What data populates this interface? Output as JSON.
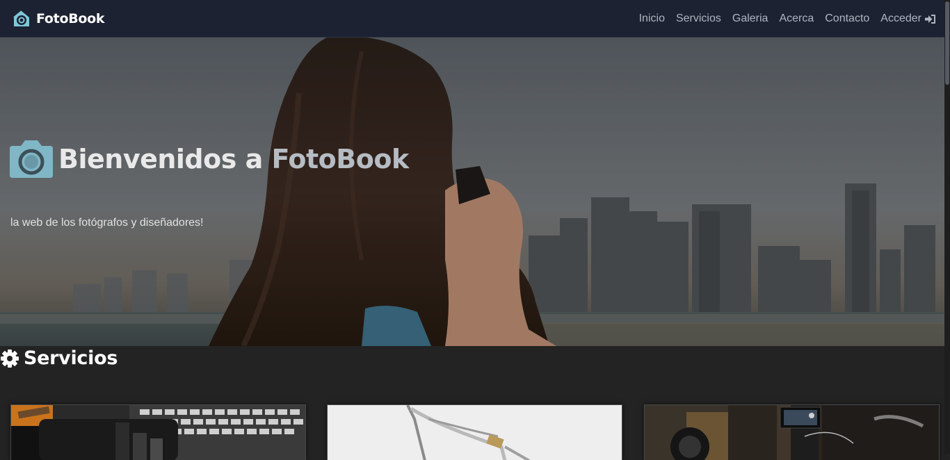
{
  "navbar": {
    "brand": "FotoBook",
    "links": [
      {
        "label": "Inicio"
      },
      {
        "label": "Servicios"
      },
      {
        "label": "Galeria"
      },
      {
        "label": "Acerca"
      },
      {
        "label": "Contacto"
      },
      {
        "label": "Acceder",
        "icon": "sign-in-icon"
      }
    ]
  },
  "hero": {
    "title_part1": "Bienvenidos a ",
    "title_part2": "FotoBook",
    "subtitle": "la web de los fotógrafos y diseñadores!",
    "icon": "camera-icon"
  },
  "services": {
    "title": "Servicios",
    "icon": "gear-icon",
    "cards": [
      {
        "image": "camera-lens-keyboard-photo"
      },
      {
        "image": "eyelash-curler-photo"
      },
      {
        "image": "video-camera-rig-photo"
      }
    ]
  },
  "colors": {
    "navbar_bg": "#1c2231",
    "accent": "#7fb7c7",
    "page_bg": "#232323"
  }
}
